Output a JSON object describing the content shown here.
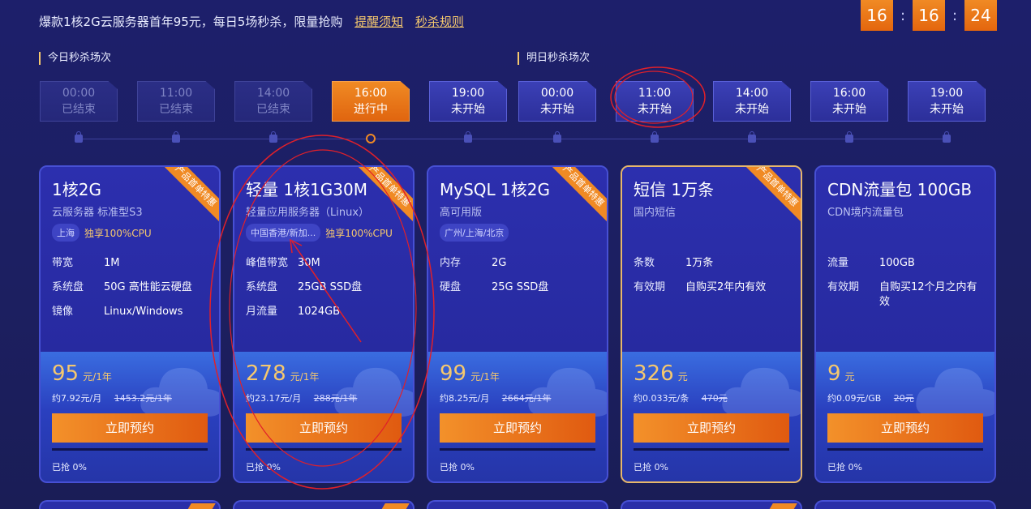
{
  "header": {
    "promo_text": "爆款1核2G云服务器首年95元，每日5场秒杀，限量抢购",
    "link_notice": "提醒须知",
    "link_rules": "秒杀规则",
    "countdown": {
      "h": "16",
      "m": "16",
      "s": "24",
      "sep": ":"
    }
  },
  "sections": {
    "today": "今日秒杀场次",
    "tomorrow": "明日秒杀场次"
  },
  "slots": [
    {
      "time": "00:00",
      "status": "已结束"
    },
    {
      "time": "11:00",
      "status": "已结束"
    },
    {
      "time": "14:00",
      "status": "已结束"
    },
    {
      "time": "16:00",
      "status": "进行中"
    },
    {
      "time": "19:00",
      "status": "未开始"
    },
    {
      "time": "00:00",
      "status": "未开始"
    },
    {
      "time": "11:00",
      "status": "未开始"
    },
    {
      "time": "14:00",
      "status": "未开始"
    },
    {
      "time": "16:00",
      "status": "未开始"
    },
    {
      "time": "19:00",
      "status": "未开始"
    }
  ],
  "cards": [
    {
      "title": "1核2G",
      "subtitle": "云服务器 标准型S3",
      "ribbon": "产品首单特惠",
      "tags": [
        "上海"
      ],
      "highlight": "独享100%CPU",
      "specs": [
        {
          "k": "带宽",
          "v": "1M"
        },
        {
          "k": "系统盘",
          "v": "50G 高性能云硬盘"
        },
        {
          "k": "镜像",
          "v": "Linux/Windows"
        }
      ],
      "price": "95",
      "unit": "元/1年",
      "monthly": "约7.92元/月",
      "original": "1453.2元/1年",
      "button": "立即预约",
      "sold_label": "已抢 0%",
      "sold_fraction": 0
    },
    {
      "title": "轻量 1核1G30M",
      "subtitle": "轻量应用服务器（Linux）",
      "ribbon": "产品首单特惠",
      "tags": [
        "中国香港/新加..."
      ],
      "highlight": "独享100%CPU",
      "specs": [
        {
          "k": "峰值带宽",
          "v": "30M"
        },
        {
          "k": "系统盘",
          "v": "25GB SSD盘"
        },
        {
          "k": "月流量",
          "v": "1024GB"
        }
      ],
      "price": "278",
      "unit": "元/1年",
      "monthly": "约23.17元/月",
      "original": "288元/1年",
      "button": "立即预约",
      "sold_label": "已抢 0%",
      "sold_fraction": 0
    },
    {
      "title": "MySQL 1核2G",
      "subtitle": "高可用版",
      "ribbon": "产品首单特惠",
      "tags": [
        "广州/上海/北京"
      ],
      "highlight": "",
      "specs": [
        {
          "k": "内存",
          "v": "2G"
        },
        {
          "k": "硬盘",
          "v": "25G SSD盘"
        }
      ],
      "price": "99",
      "unit": "元/1年",
      "monthly": "约8.25元/月",
      "original": "2664元/1年",
      "button": "立即预约",
      "sold_label": "已抢 0%",
      "sold_fraction": 0
    },
    {
      "title": "短信 1万条",
      "subtitle": "国内短信",
      "ribbon": "产品首单特惠",
      "tags": [],
      "highlight": "",
      "specs": [
        {
          "k": "条数",
          "v": "1万条"
        },
        {
          "k": "有效期",
          "v": "自购买2年内有效"
        }
      ],
      "price": "326",
      "unit": "元",
      "monthly": "约0.033元/条",
      "original": "470元",
      "button": "立即预约",
      "sold_label": "已抢 0%",
      "sold_fraction": 0
    },
    {
      "title": "CDN流量包 100GB",
      "subtitle": "CDN境内流量包",
      "ribbon": "",
      "tags": [],
      "highlight": "",
      "specs": [
        {
          "k": "流量",
          "v": "100GB"
        },
        {
          "k": "有效期",
          "v": "自购买12个月之内有效"
        }
      ],
      "price": "9",
      "unit": "元",
      "monthly": "约0.09元/GB",
      "original": "20元",
      "button": "立即预约",
      "sold_label": "已抢 0%",
      "sold_fraction": 0
    }
  ],
  "colors": {
    "accent": "#f08a24",
    "gold": "#f5c86e",
    "annotation": "#e0202a"
  }
}
